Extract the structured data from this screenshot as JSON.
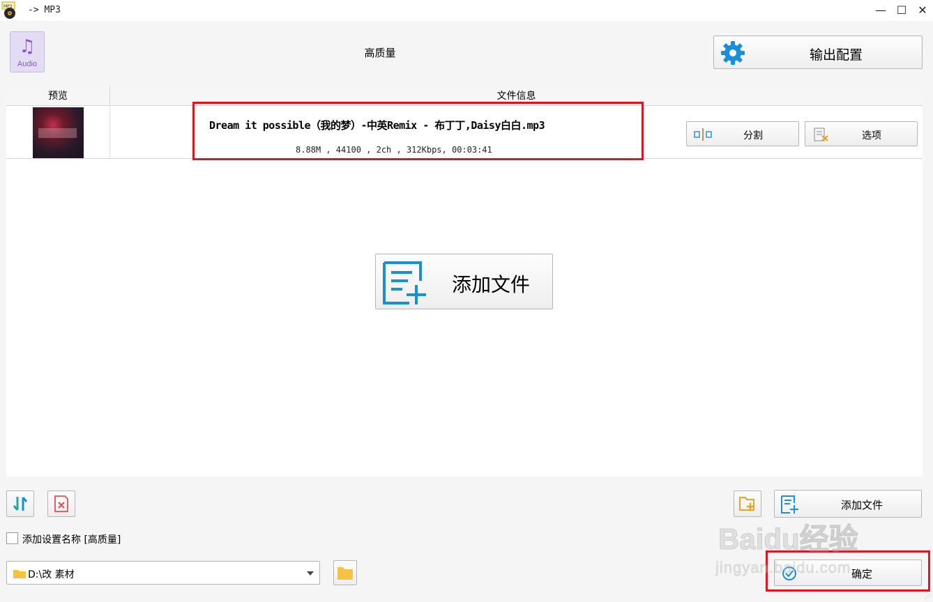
{
  "window": {
    "title": "-> MP3",
    "minimize_glyph": "—",
    "maximize_glyph": "☐",
    "close_glyph": "✕"
  },
  "header": {
    "audio_tile_label": "Audio",
    "quality_label": "高质量",
    "output_config_label": "输出配置"
  },
  "table": {
    "columns": [
      "预览",
      "文件信息"
    ],
    "rows": [
      {
        "file_name": "Dream it possible（我的梦）-中英Remix - 布丁丁,Daisy白白.mp3",
        "meta": "8.88M , 44100 , 2ch , 312Kbps, 00:03:41",
        "split_label": "分割",
        "options_label": "选项"
      }
    ],
    "add_file_label": "添加文件"
  },
  "bottom": {
    "add_setting_name_label": "添加设置名称 [高质量]",
    "add_setting_name_checked": false,
    "output_path": "D:\\改  素材",
    "add_file_label": "添加文件",
    "ok_label": "确定"
  },
  "watermark": {
    "line1": "Baidu经验",
    "line2": "jingyan.baidu.com"
  },
  "colors": {
    "highlight_red": "#e0161f",
    "accent_blue": "#1a8fd8",
    "audio_purple": "#8a55d8",
    "folder_yellow": "#f5c342"
  },
  "icons": [
    "app-mp3-icon",
    "audio-note-icon",
    "gear-icon",
    "split-icon",
    "options-icon",
    "add-file-icon",
    "sort-icon",
    "delete-icon",
    "folder-add-icon",
    "folder-icon",
    "check-circle-icon"
  ]
}
